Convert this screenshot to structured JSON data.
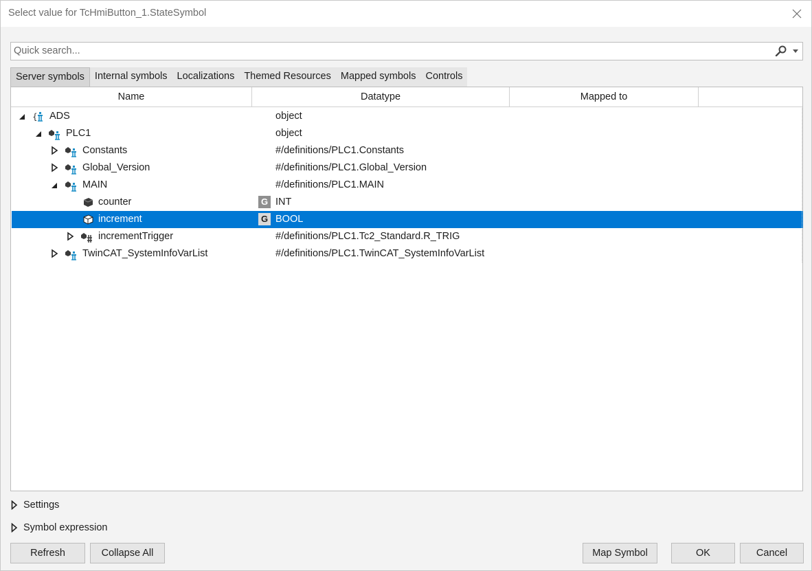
{
  "window": {
    "title": "Select value for TcHmiButton_1.StateSymbol"
  },
  "search": {
    "placeholder": "Quick search...",
    "value": ""
  },
  "tabs": [
    {
      "label": "Server symbols",
      "active": true
    },
    {
      "label": "Internal symbols"
    },
    {
      "label": "Localizations"
    },
    {
      "label": "Themed Resources"
    },
    {
      "label": "Mapped symbols"
    },
    {
      "label": "Controls"
    }
  ],
  "columns": {
    "name": "Name",
    "datatype": "Datatype",
    "mapped": "Mapped to"
  },
  "rows": [
    {
      "name": "ADS",
      "datatype": "object",
      "expander": "expanded",
      "icon": "ads-root-icon"
    },
    {
      "name": "PLC1",
      "datatype": "object",
      "expander": "expanded",
      "icon": "symbol-group-icon"
    },
    {
      "name": "Constants",
      "datatype": "#/definitions/PLC1.Constants",
      "expander": "collapsed",
      "icon": "symbol-group-icon"
    },
    {
      "name": "Global_Version",
      "datatype": "#/definitions/PLC1.Global_Version",
      "expander": "collapsed",
      "icon": "symbol-group-icon"
    },
    {
      "name": "MAIN",
      "datatype": "#/definitions/PLC1.MAIN",
      "expander": "expanded",
      "icon": "symbol-group-icon"
    },
    {
      "name": "counter",
      "datatype": "INT",
      "badge": "G",
      "icon": "variable-icon"
    },
    {
      "name": "increment",
      "datatype": "BOOL",
      "badge": "G",
      "icon": "variable-icon",
      "selected": true
    },
    {
      "name": "incrementTrigger",
      "datatype": "#/definitions/PLC1.Tc2_Standard.R_TRIG",
      "expander": "collapsed",
      "icon": "function-block-icon"
    },
    {
      "name": "TwinCAT_SystemInfoVarList",
      "datatype": "#/definitions/PLC1.TwinCAT_SystemInfoVarList",
      "expander": "collapsed",
      "icon": "symbol-group-icon"
    }
  ],
  "sections": {
    "settings": "Settings",
    "symbol_expression": "Symbol expression"
  },
  "buttons": {
    "refresh": "Refresh",
    "collapse_all": "Collapse All",
    "map_symbol": "Map Symbol",
    "ok": "OK",
    "cancel": "Cancel"
  },
  "colors": {
    "selection": "#0078d4",
    "accent_icon": "#1e90c8"
  }
}
